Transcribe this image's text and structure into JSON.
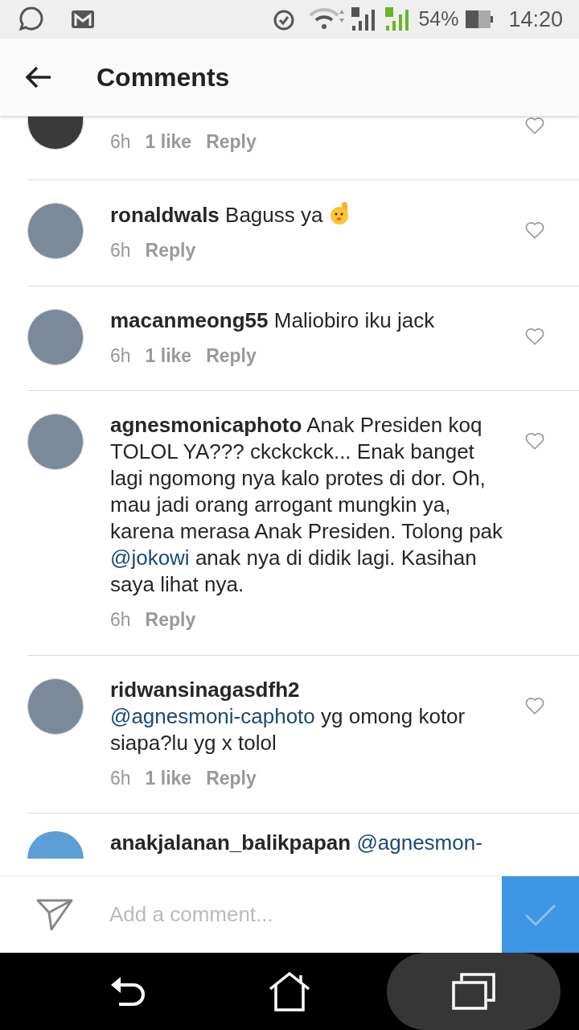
{
  "status_bar": {
    "battery": "54%",
    "time": "14:20"
  },
  "header": {
    "title": "Comments"
  },
  "comments": [
    {
      "kind": "partial-top",
      "time": "6h",
      "likes": "1 like",
      "reply": "Reply"
    },
    {
      "kind": "full",
      "username": "ronaldwals",
      "parts": [
        {
          "kind": "text",
          "text": "Baguss ya"
        }
      ],
      "emoji": true,
      "time": "6h",
      "reply": "Reply"
    },
    {
      "kind": "full",
      "username": "macanmeong55",
      "parts": [
        {
          "kind": "text",
          "text": "Maliobiro iku jack"
        }
      ],
      "time": "6h",
      "likes": "1 like",
      "reply": "Reply"
    },
    {
      "kind": "full",
      "username": "agnesmonicaphoto",
      "parts": [
        {
          "kind": "text",
          "text": "Anak Presiden koq TOLOL YA??? ckckckck... Enak banget lagi ngomong nya kalo protes di dor. Oh, mau jadi orang arrogant mungkin ya, karena merasa Anak Presiden. Tolong pak"
        },
        {
          "kind": "mention",
          "text": "@jokowi"
        },
        {
          "kind": "text",
          "text": "anak nya di didik lagi. Kasihan saya lihat nya."
        }
      ],
      "time": "6h",
      "reply": "Reply"
    },
    {
      "kind": "full",
      "username": "ridwansinagasdfh2",
      "parts": [
        {
          "kind": "mention",
          "text": "@agnesmoni-caphoto"
        },
        {
          "kind": "text",
          "text": " yg omong kotor siapa?lu yg x tolol"
        }
      ],
      "time": "6h",
      "likes": "1 like",
      "reply": "Reply"
    },
    {
      "kind": "partial-bottom",
      "username": "anakjalanan_balikpapan",
      "parts": [
        {
          "kind": "mention",
          "text": "@agnesmon-"
        }
      ]
    }
  ],
  "composer": {
    "placeholder": "Add a comment..."
  }
}
